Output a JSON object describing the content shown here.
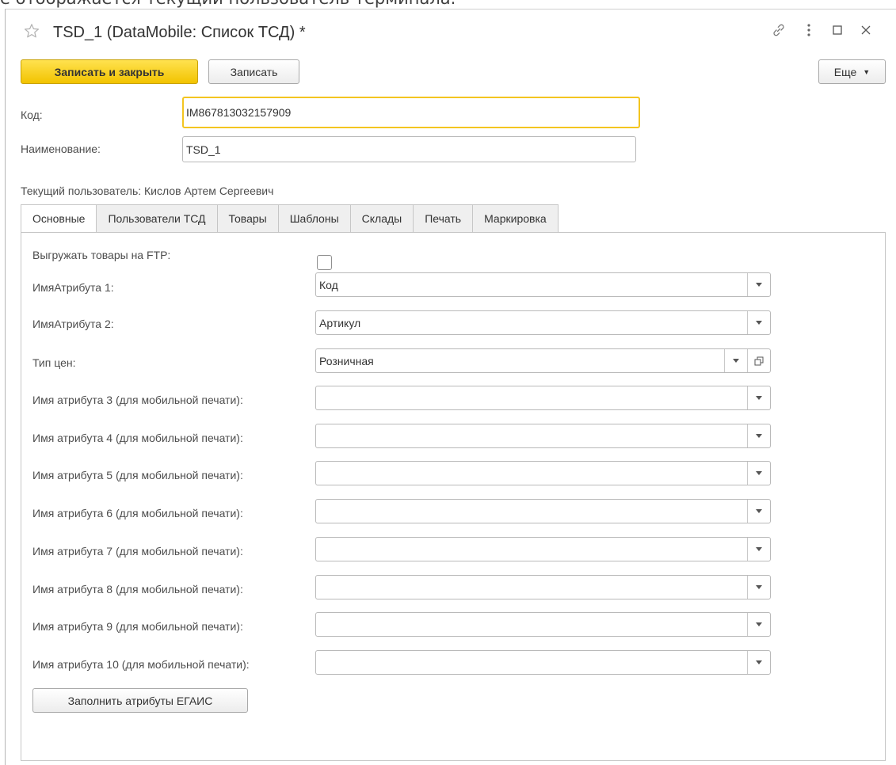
{
  "background_text": "е отображается текущий пользователь терминала.",
  "window": {
    "title": "TSD_1 (DataMobile: Список ТСД) *",
    "icons": [
      "star-icon",
      "link-icon",
      "menu-icon",
      "maximize-icon",
      "close-icon"
    ]
  },
  "toolbar": {
    "save_close_label": "Записать и закрыть",
    "save_label": "Записать",
    "more_label": "Еще"
  },
  "fields": {
    "code_label": "Код:",
    "code_value": "IM867813032157909",
    "name_label": "Наименование:",
    "name_value": "TSD_1",
    "current_user": "Текущий пользователь: Кислов Артем Сергеевич"
  },
  "tabs": [
    {
      "label": "Основные"
    },
    {
      "label": "Пользователи ТСД"
    },
    {
      "label": "Товары"
    },
    {
      "label": "Шаблоны"
    },
    {
      "label": "Склады"
    },
    {
      "label": "Печать"
    },
    {
      "label": "Маркировка"
    }
  ],
  "main": {
    "ftp_label": "Выгружать товары на FTP:",
    "ftp_checked": false,
    "attr1_label": "ИмяАтрибута 1:",
    "attr1_value": "Код",
    "attr2_label": "ИмяАтрибута 2:",
    "attr2_value": "Артикул",
    "price_label": "Тип цен:",
    "price_value": "Розничная",
    "mobile_attrs": [
      {
        "label": "Имя атрибута 3 (для мобильной печати):",
        "value": ""
      },
      {
        "label": "Имя атрибута 4 (для мобильной печати):",
        "value": ""
      },
      {
        "label": "Имя атрибута 5 (для мобильной печати):",
        "value": ""
      },
      {
        "label": "Имя атрибута 6 (для мобильной печати):",
        "value": ""
      },
      {
        "label": "Имя атрибута 7 (для мобильной печати):",
        "value": ""
      },
      {
        "label": "Имя атрибута 8 (для мобильной печати):",
        "value": ""
      },
      {
        "label": "Имя атрибута 9 (для мобильной печати):",
        "value": ""
      },
      {
        "label": "Имя атрибута 10 (для мобильной печати):",
        "value": ""
      }
    ],
    "fill_button_label": "Заполнить атрибуты ЕГАИС"
  },
  "colors": {
    "primary_button": "#f2c300",
    "focus_border": "#f3c520",
    "border": "#b9b9b9"
  }
}
